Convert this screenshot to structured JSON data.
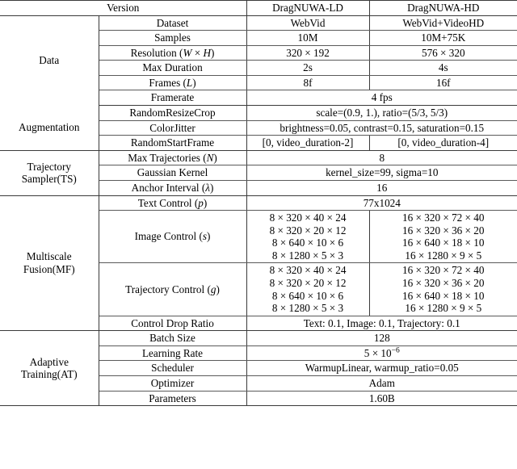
{
  "table": {
    "header": {
      "version_label": "Version",
      "col_ld": "DragNUWA-LD",
      "col_hd": "DragNUWA-HD"
    },
    "categories": {
      "data": "Data",
      "augmentation": "Augmentation",
      "trajectory_sampler_line1": "Trajectory",
      "trajectory_sampler_line2": "Sampler(TS)",
      "multiscale_fusion_line1": "Multiscale",
      "multiscale_fusion_line2": "Fusion(MF)",
      "adaptive_training_line1": "Adaptive",
      "adaptive_training_line2": "Training(AT)"
    },
    "rows": {
      "dataset": {
        "label": "Dataset",
        "ld": "WebVid",
        "hd": "WebVid+VideoHD"
      },
      "samples": {
        "label": "Samples",
        "ld": "10M",
        "hd": "10M+75K"
      },
      "resolution": {
        "label_prefix": "Resolution (",
        "label_w": "W",
        "label_times": " × ",
        "label_h": "H",
        "label_suffix": ")",
        "ld": "320 × 192",
        "hd": "576 × 320"
      },
      "max_duration": {
        "label": "Max Duration",
        "ld": "2s",
        "hd": "4s"
      },
      "frames": {
        "label_prefix": "Frames (",
        "label_sym": "L",
        "label_suffix": ")",
        "ld": "8f",
        "hd": "16f"
      },
      "framerate": {
        "label": "Framerate",
        "value": "4 fps"
      },
      "random_resize_crop": {
        "label": "RandomResizeCrop",
        "value": "scale=(0.9, 1.), ratio=(5/3, 5/3)"
      },
      "color_jitter": {
        "label": "ColorJitter",
        "value": "brightness=0.05, contrast=0.15, saturation=0.15"
      },
      "random_start_frame": {
        "label": "RandomStartFrame",
        "ld": "[0, video_duration-2]",
        "hd": "[0, video_duration-4]"
      },
      "max_trajectories": {
        "label_prefix": "Max Trajectories (",
        "label_sym": "N",
        "label_suffix": ")",
        "value": "8"
      },
      "gaussian_kernel": {
        "label": "Gaussian Kernel",
        "value": "kernel_size=99, sigma=10"
      },
      "anchor_interval": {
        "label_prefix": "Anchor Interval (",
        "label_sym": "λ",
        "label_suffix": ")",
        "value": "16"
      },
      "text_control": {
        "label_prefix": "Text Control (",
        "label_sym": "p",
        "label_suffix": ")",
        "value": "77x1024"
      },
      "image_control": {
        "label_prefix": "Image Control (",
        "label_sym": "s",
        "label_suffix": ")",
        "ld_lines": [
          "8 × 320 × 40 × 24",
          "8 × 320 × 20 × 12",
          "8 × 640 × 10 × 6",
          "8 × 1280 × 5 × 3"
        ],
        "hd_lines": [
          "16 × 320 × 72 × 40",
          "16 × 320 × 36 × 20",
          "16 × 640 × 18 × 10",
          "16 × 1280 × 9 × 5"
        ]
      },
      "trajectory_control": {
        "label_prefix": "Trajectory Control (",
        "label_sym": "g",
        "label_suffix": ")",
        "ld_lines": [
          "8 × 320 × 40 × 24",
          "8 × 320 × 20 × 12",
          "8 × 640 × 10 × 6",
          "8 × 1280 × 5 × 3"
        ],
        "hd_lines": [
          "16 × 320 × 72 × 40",
          "16 × 320 × 36 × 20",
          "16 × 640 × 18 × 10",
          "16 × 1280 × 9 × 5"
        ]
      },
      "control_drop_ratio": {
        "label": "Control Drop Ratio",
        "value": "Text: 0.1, Image: 0.1, Trajectory: 0.1"
      },
      "batch_size": {
        "label": "Batch Size",
        "value": "128"
      },
      "learning_rate": {
        "label": "Learning Rate",
        "value_base": "5 × 10",
        "value_exp": "−6"
      },
      "scheduler": {
        "label": "Scheduler",
        "value": "WarmupLinear, warmup_ratio=0.05"
      },
      "optimizer": {
        "label": "Optimizer",
        "value": "Adam"
      },
      "parameters": {
        "label": "Parameters",
        "value": "1.60B"
      }
    }
  }
}
